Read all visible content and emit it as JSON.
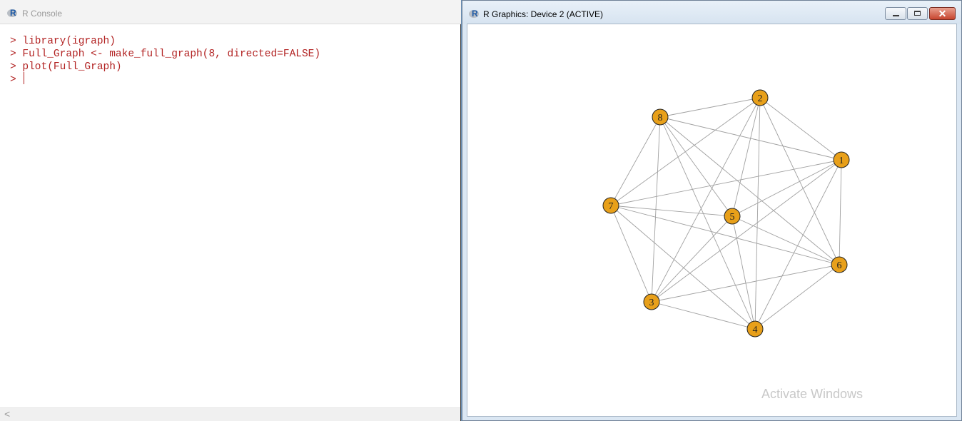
{
  "console": {
    "title": "R Console",
    "lines": [
      "> library(igraph)",
      "> Full_Graph <- make_full_graph(8, directed=FALSE)",
      "> plot(Full_Graph)",
      "> "
    ],
    "hscroll_left": "<"
  },
  "graphics": {
    "title": "R Graphics: Device 2 (ACTIVE)",
    "close_glyph": "✕",
    "watermark": "Activate Windows"
  },
  "graph": {
    "directed": false,
    "vertex_color": "#e8a01a",
    "edge_color": "#a0a0a0",
    "nodes": [
      {
        "id": "1",
        "label": "1"
      },
      {
        "id": "2",
        "label": "2"
      },
      {
        "id": "3",
        "label": "3"
      },
      {
        "id": "4",
        "label": "4"
      },
      {
        "id": "5",
        "label": "5"
      },
      {
        "id": "6",
        "label": "6"
      },
      {
        "id": "7",
        "label": "7"
      },
      {
        "id": "8",
        "label": "8"
      }
    ],
    "edges": [
      [
        "1",
        "2"
      ],
      [
        "1",
        "3"
      ],
      [
        "1",
        "4"
      ],
      [
        "1",
        "5"
      ],
      [
        "1",
        "6"
      ],
      [
        "1",
        "7"
      ],
      [
        "1",
        "8"
      ],
      [
        "2",
        "3"
      ],
      [
        "2",
        "4"
      ],
      [
        "2",
        "5"
      ],
      [
        "2",
        "6"
      ],
      [
        "2",
        "7"
      ],
      [
        "2",
        "8"
      ],
      [
        "3",
        "4"
      ],
      [
        "3",
        "5"
      ],
      [
        "3",
        "6"
      ],
      [
        "3",
        "7"
      ],
      [
        "3",
        "8"
      ],
      [
        "4",
        "5"
      ],
      [
        "4",
        "6"
      ],
      [
        "4",
        "7"
      ],
      [
        "4",
        "8"
      ],
      [
        "5",
        "6"
      ],
      [
        "5",
        "7"
      ],
      [
        "5",
        "8"
      ],
      [
        "6",
        "7"
      ],
      [
        "6",
        "8"
      ],
      [
        "7",
        "8"
      ]
    ]
  }
}
